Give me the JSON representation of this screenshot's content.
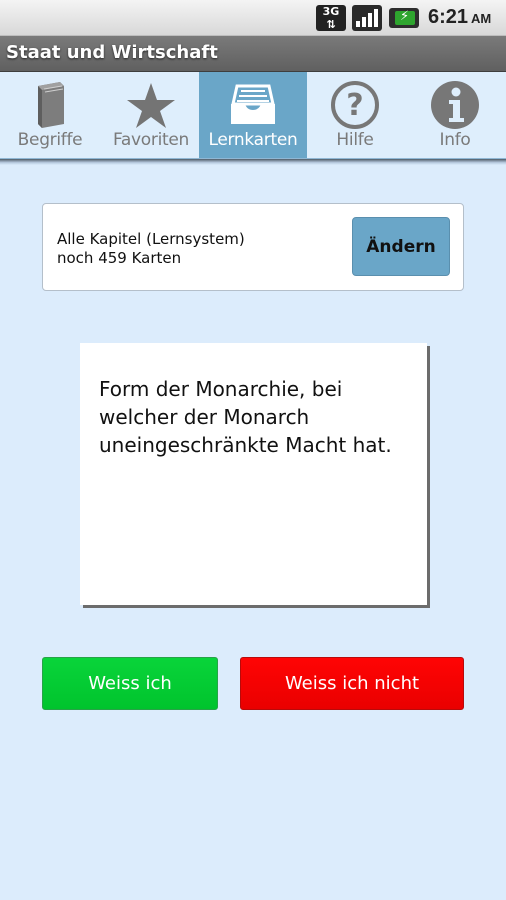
{
  "status_bar": {
    "network_label": "3G",
    "network_arrows": "⇅",
    "battery_glyph": "⚡",
    "time": "6:21",
    "ampm": "AM"
  },
  "app": {
    "title": "Staat und Wirtschaft"
  },
  "tabs": [
    {
      "label": "Begriffe",
      "icon": "book-icon",
      "active": false
    },
    {
      "label": "Favoriten",
      "icon": "star-icon",
      "active": false
    },
    {
      "label": "Lernkarten",
      "icon": "card-tray-icon",
      "active": true
    },
    {
      "label": "Hilfe",
      "icon": "help-icon",
      "active": false
    },
    {
      "label": "Info",
      "icon": "info-icon",
      "active": false
    }
  ],
  "deck": {
    "chapter": "Alle Kapitel (Lernsystem)",
    "remaining": "noch 459 Karten",
    "change_label": "Ändern"
  },
  "card": {
    "text": "Form der Monarchie, bei welcher der Monarch uneingeschränkte Macht hat."
  },
  "answers": {
    "know_label": "Weiss ich",
    "dont_know_label": "Weiss ich nicht",
    "know_color": "#00cc33",
    "dont_know_color": "#ff0000"
  },
  "colors": {
    "accent": "#6aa6c8",
    "background": "#dcecfc"
  }
}
